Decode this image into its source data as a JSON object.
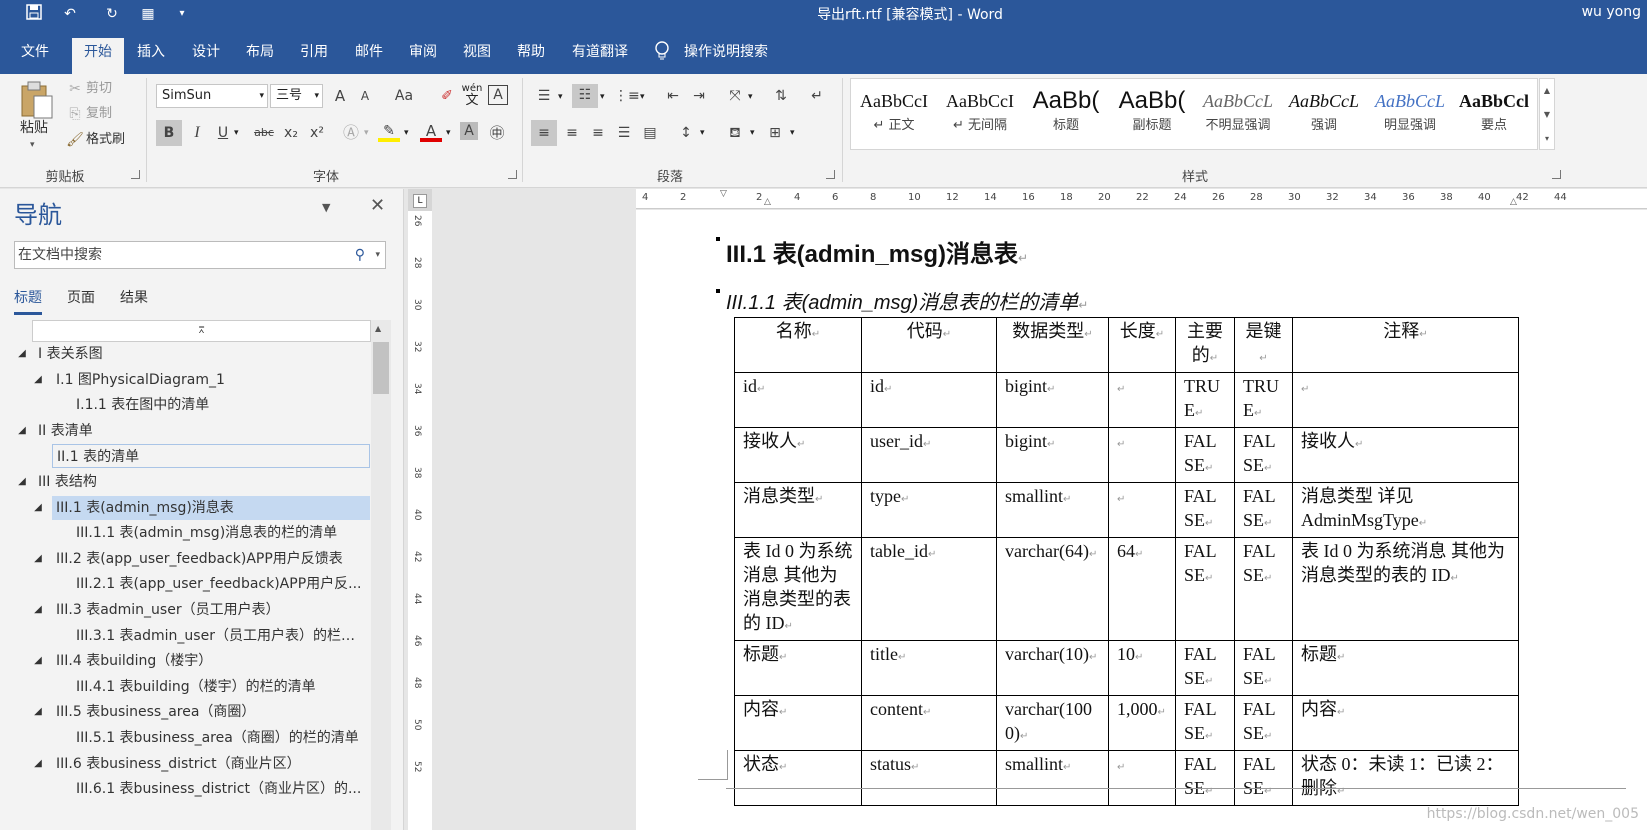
{
  "window": {
    "title": "导出rft.rtf [兼容模式] - Word",
    "user": "wu yong"
  },
  "quick_access": {
    "icons": [
      "save-icon",
      "undo-icon",
      "redo-icon",
      "table-icon",
      "customize-icon"
    ]
  },
  "menu": {
    "tabs": [
      "文件",
      "开始",
      "插入",
      "设计",
      "布局",
      "引用",
      "邮件",
      "审阅",
      "视图",
      "帮助",
      "有道翻译",
      "操作说明搜索"
    ],
    "active": "开始"
  },
  "ribbon": {
    "clipboard": {
      "label": "剪贴板",
      "paste": "粘贴",
      "cut": "剪切",
      "copy": "复制",
      "format_painter": "格式刷"
    },
    "font": {
      "label": "字体",
      "name": "SimSun",
      "size": "三号",
      "grow": "A",
      "shrink": "A",
      "case": "Aa",
      "bold": "B",
      "italic": "I",
      "underline": "U",
      "strike": "abc",
      "sub": "x₂",
      "sup": "x²",
      "wen": "wén",
      "wen_char": "文"
    },
    "paragraph": {
      "label": "段落"
    },
    "styles": {
      "label": "样式",
      "items": [
        {
          "sample": "AaBbCcI",
          "name": "正文"
        },
        {
          "sample": "AaBbCcI",
          "name": "无间隔"
        },
        {
          "sample": "AaBb(",
          "name": "标题"
        },
        {
          "sample": "AaBb(",
          "name": "副标题"
        },
        {
          "sample": "AaBbCcL",
          "name": "不明显强调"
        },
        {
          "sample": "AaBbCcL",
          "name": "强调"
        },
        {
          "sample": "AaBbCcL",
          "name": "明显强调"
        },
        {
          "sample": "AaBbCcl",
          "name": "要点"
        }
      ]
    }
  },
  "navigation": {
    "title": "导航",
    "search_placeholder": "在文档中搜索",
    "tabs": [
      "标题",
      "页面",
      "结果"
    ],
    "active_tab": "标题",
    "tree": [
      {
        "text": "I 表关系图",
        "level": 0,
        "arrow": true
      },
      {
        "text": "I.1 图PhysicalDiagram_1",
        "level": 1,
        "arrow": true
      },
      {
        "text": "I.1.1 表在图中的清单",
        "level": 2,
        "arrow": false
      },
      {
        "text": "II 表清单",
        "level": 0,
        "arrow": true
      },
      {
        "text": "II.1 表的清单",
        "level": 1,
        "arrow": false,
        "outlined": true
      },
      {
        "text": "III 表结构",
        "level": 0,
        "arrow": true
      },
      {
        "text": "III.1 表(admin_msg)消息表",
        "level": 1,
        "arrow": true,
        "selected": true
      },
      {
        "text": "III.1.1 表(admin_msg)消息表的栏的清单",
        "level": 2,
        "arrow": false
      },
      {
        "text": "III.2 表(app_user_feedback)APP用户反馈表",
        "level": 1,
        "arrow": true
      },
      {
        "text": "III.2.1 表(app_user_feedback)APP用户反...",
        "level": 2,
        "arrow": false
      },
      {
        "text": "III.3 表admin_user（员工用户表）",
        "level": 1,
        "arrow": true
      },
      {
        "text": "III.3.1 表admin_user（员工用户表）的栏的...",
        "level": 2,
        "arrow": false
      },
      {
        "text": "III.4 表building（楼宇）",
        "level": 1,
        "arrow": true
      },
      {
        "text": "III.4.1 表building（楼宇）的栏的清单",
        "level": 2,
        "arrow": false
      },
      {
        "text": "III.5 表business_area（商圈）",
        "level": 1,
        "arrow": true
      },
      {
        "text": "III.5.1 表business_area（商圈）的栏的清单",
        "level": 2,
        "arrow": false
      },
      {
        "text": "III.6 表business_district（商业片区）",
        "level": 1,
        "arrow": true
      },
      {
        "text": "III.6.1 表business_district（商业片区）的...",
        "level": 2,
        "arrow": false
      }
    ]
  },
  "ruler": {
    "h_ticks": [
      "4",
      "2",
      "",
      "2",
      "4",
      "6",
      "8",
      "10",
      "12",
      "14",
      "16",
      "18",
      "20",
      "22",
      "24",
      "26",
      "28",
      "30",
      "32",
      "34",
      "36",
      "38",
      "40",
      "42",
      "44"
    ],
    "v_ticks": [
      "26",
      "28",
      "30",
      "32",
      "34",
      "36",
      "38",
      "40",
      "42",
      "44",
      "46",
      "48",
      "50",
      "52"
    ]
  },
  "document": {
    "heading1": "III.1 表(admin_msg)消息表",
    "heading2": "III.1.1 表(admin_msg)消息表的栏的清单",
    "table": {
      "headers": [
        "名称",
        "代码",
        "数据类型",
        "长度",
        "主要的",
        "是键",
        "注释"
      ],
      "rows": [
        [
          "id",
          "id",
          "bigint",
          "",
          "TRUE",
          "TRUE",
          ""
        ],
        [
          "接收人",
          "user_id",
          "bigint",
          "",
          "FALSE",
          "FALSE",
          "接收人"
        ],
        [
          "消息类型",
          "type",
          "smallint",
          "",
          "FALSE",
          "FALSE",
          "消息类型 详见AdminMsgType"
        ],
        [
          "表 Id 0 为系统消息 其他为消息类型的表的 ID",
          "table_id",
          "varchar(64)",
          "64",
          "FALSE",
          "FALSE",
          "表 Id 0 为系统消息 其他为消息类型的表的 ID"
        ],
        [
          "标题",
          "title",
          "varchar(10)",
          "10",
          "FALSE",
          "FALSE",
          "标题"
        ],
        [
          "内容",
          "content",
          "varchar(1000)",
          "1,000",
          "FALSE",
          "FALSE",
          "内容"
        ],
        [
          "状态",
          "status",
          "smallint",
          "",
          "FALSE",
          "FALSE",
          "状态 0：未读 1：已读 2：删除"
        ]
      ]
    },
    "watermark": "https://blog.csdn.net/wen_005"
  }
}
